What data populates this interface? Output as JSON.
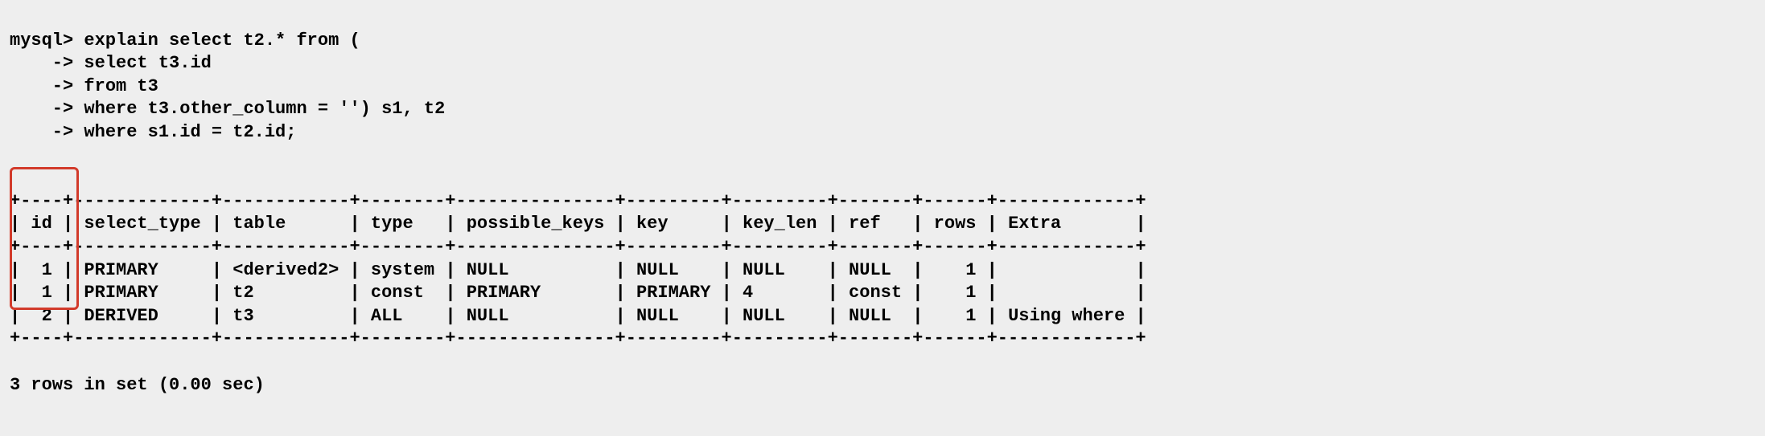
{
  "prompt": "mysql>",
  "cont": "    ->",
  "query": {
    "line1": "explain select t2.* from (",
    "line2": "select t3.id",
    "line3": "from t3",
    "line4": "where t3.other_column = '') s1, t2",
    "line5": "where s1.id = t2.id;"
  },
  "columns": {
    "c0": "id",
    "c1": "select_type",
    "c2": "table",
    "c3": "type",
    "c4": "possible_keys",
    "c5": "key",
    "c6": "key_len",
    "c7": "ref",
    "c8": "rows",
    "c9": "Extra"
  },
  "rows": [
    {
      "c0": "1",
      "c1": "PRIMARY",
      "c2": "<derived2>",
      "c3": "system",
      "c4": "NULL",
      "c5": "NULL",
      "c6": "NULL",
      "c7": "NULL",
      "c8": "1",
      "c9": ""
    },
    {
      "c0": "1",
      "c1": "PRIMARY",
      "c2": "t2",
      "c3": "const",
      "c4": "PRIMARY",
      "c5": "PRIMARY",
      "c6": "4",
      "c7": "const",
      "c8": "1",
      "c9": ""
    },
    {
      "c0": "2",
      "c1": "DERIVED",
      "c2": "t3",
      "c3": "ALL",
      "c4": "NULL",
      "c5": "NULL",
      "c6": "NULL",
      "c7": "NULL",
      "c8": "1",
      "c9": "Using where"
    }
  ],
  "footer": "3 rows in set (0.00 sec)",
  "chart_data": {
    "type": "table",
    "title": "MySQL EXPLAIN output",
    "columns": [
      "id",
      "select_type",
      "table",
      "type",
      "possible_keys",
      "key",
      "key_len",
      "ref",
      "rows",
      "Extra"
    ],
    "data": [
      [
        1,
        "PRIMARY",
        "<derived2>",
        "system",
        "NULL",
        "NULL",
        "NULL",
        "NULL",
        1,
        ""
      ],
      [
        1,
        "PRIMARY",
        "t2",
        "const",
        "PRIMARY",
        "PRIMARY",
        "4",
        "const",
        1,
        ""
      ],
      [
        2,
        "DERIVED",
        "t3",
        "ALL",
        "NULL",
        "NULL",
        "NULL",
        "NULL",
        1,
        "Using where"
      ]
    ]
  }
}
